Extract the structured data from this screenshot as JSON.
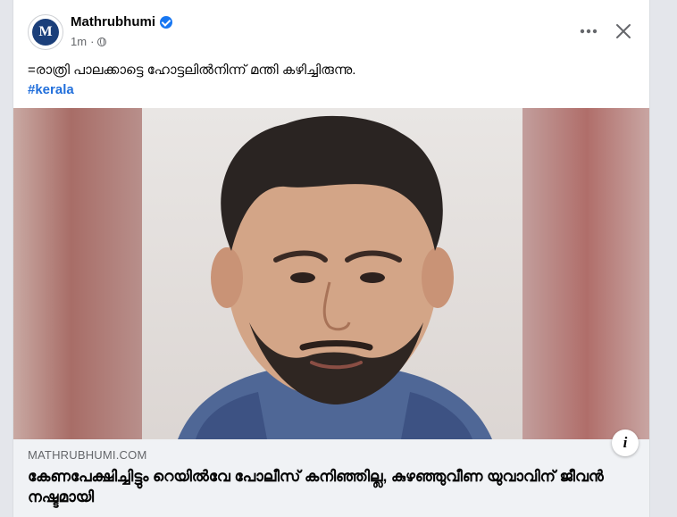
{
  "post": {
    "page_name": "Mathrubhumi",
    "avatar_letter": "M",
    "time": "1m",
    "separator": "·",
    "caption": "=രാത്രി പാലക്കാട്ടെ ഹോട്ടലിൽനിന്ന് മന്തി കഴിച്ചിരുന്നു.",
    "hashtag": "#kerala"
  },
  "link": {
    "domain": "MATHRUBHUMI.COM",
    "headline": "കേണപേക്ഷിച്ചിട്ടും റെയിൽവേ പോലീസ് കനിഞ്ഞില്ല, കുഴഞ്ഞുവീണ യുവാവിന് ജീവൻ നഷ്ടമായി",
    "info_label": "i"
  },
  "icons": {
    "verified": "verified-badge-icon",
    "privacy": "globe-icon",
    "more": "more-options-icon",
    "close": "close-icon",
    "info": "info-icon"
  },
  "colors": {
    "accent": "#1877f2",
    "hashtag": "#216fdb",
    "link_bg": "#f0f2f5"
  }
}
